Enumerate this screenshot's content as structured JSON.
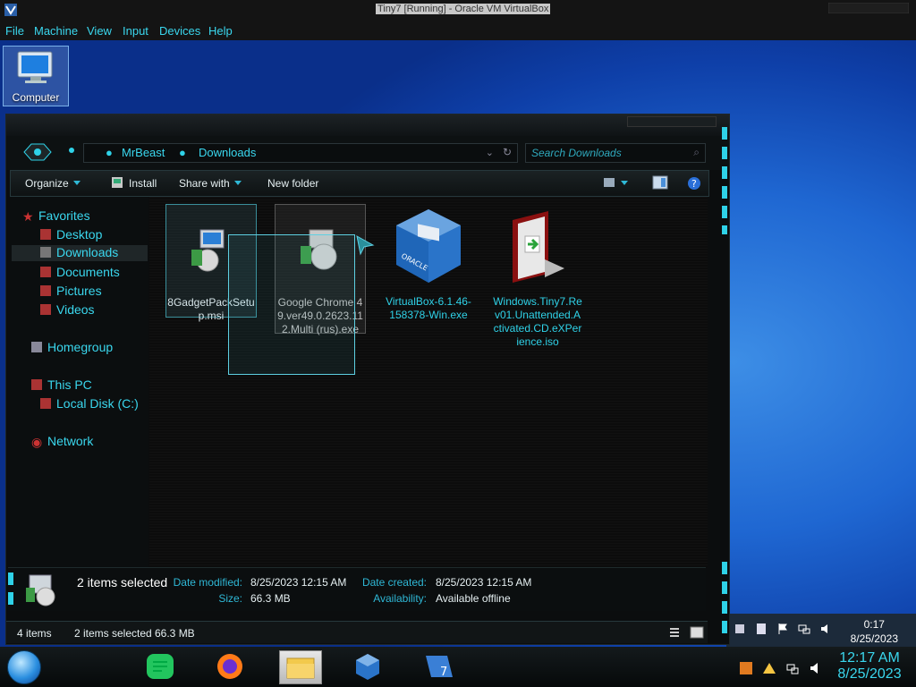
{
  "vbox": {
    "window_title": "Tiny7 [Running] - Oracle VM VirtualBox",
    "menu": [
      "File",
      "Machine",
      "View",
      "Input",
      "Devices",
      "Help"
    ]
  },
  "desktop": {
    "icons": [
      {
        "label": "Computer",
        "icon": "computer-icon"
      }
    ]
  },
  "explorer": {
    "breadcrumb": [
      "MrBeast",
      "Downloads"
    ],
    "search_placeholder": "Search Downloads",
    "toolbar": {
      "organize": "Organize",
      "install": "Install",
      "share_with": "Share with",
      "new_folder": "New folder"
    },
    "nav": {
      "favorites": "Favorites",
      "desktop": "Desktop",
      "downloads": "Downloads",
      "documents": "Documents",
      "pictures": "Pictures",
      "videos": "Videos",
      "homegroup": "Homegroup",
      "this_pc": "This PC",
      "local_disk": "Local Disk (C:)",
      "network": "Network"
    },
    "files": [
      {
        "name": "8GadgetPackSetup.msi",
        "selected": true,
        "icon": "installer-icon"
      },
      {
        "name": "Google Chrome 49.ver49.0.2623.112.Multi (rus).exe",
        "selected": true,
        "icon": "installer-icon"
      },
      {
        "name": "VirtualBox-6.1.46-158378-Win.exe",
        "selected": false,
        "icon": "virtualbox-icon"
      },
      {
        "name": "Windows.Tiny7.Rev01.Unattended.Activated.CD.eXPerience.iso",
        "selected": false,
        "icon": "disc-image-icon"
      }
    ],
    "details": {
      "count": "2 items selected",
      "date_modified_label": "Date modified:",
      "date_modified": "8/25/2023 12:15 AM",
      "size_label": "Size:",
      "size": "66.3 MB",
      "date_created_label": "Date created:",
      "date_created": "8/25/2023 12:15 AM",
      "availability_label": "Availability:",
      "availability": "Available offline"
    },
    "status": {
      "items": "4 items",
      "selected": "2 items selected",
      "size": "66.3 MB"
    }
  },
  "taskbar": {
    "apps": [
      "notes-icon",
      "firefox-icon",
      "file-explorer-icon",
      "virtualbox-icon",
      "tiny7-icon"
    ],
    "time": "12:17 AM",
    "date": "8/25/2023"
  },
  "host_tray": {
    "time": "0:17",
    "date": "8/25/2023"
  },
  "colors": {
    "accent": "#3ad7ee",
    "desktop_blue": "#1f67d2",
    "window_bg": "#0b0d0e"
  }
}
